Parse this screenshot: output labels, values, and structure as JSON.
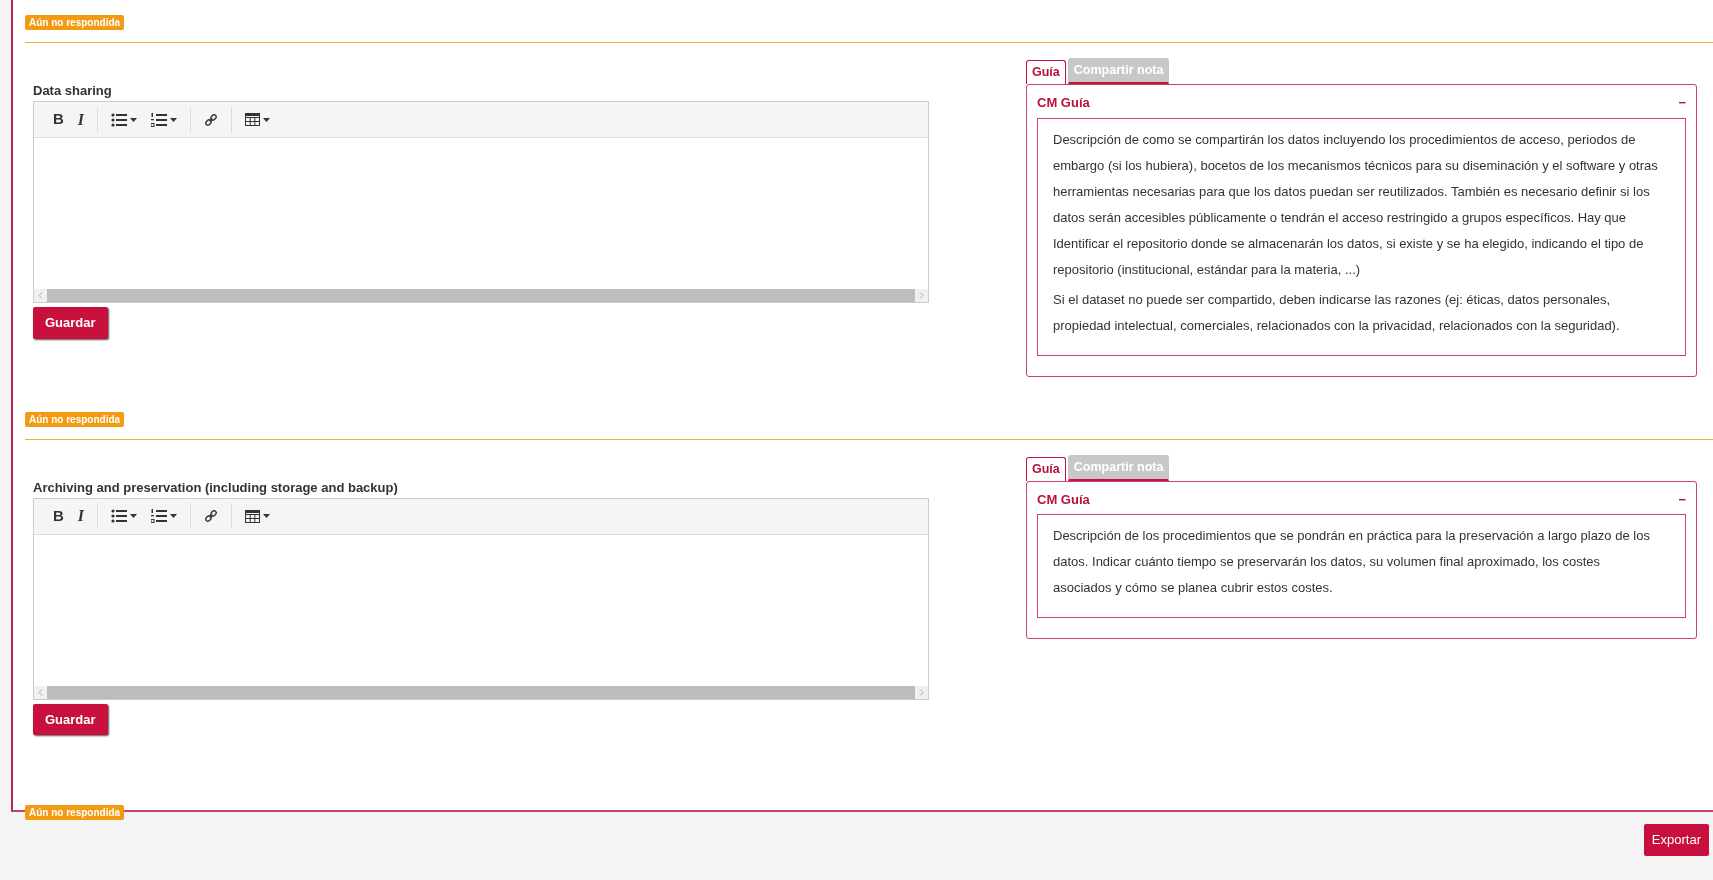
{
  "questions": [
    {
      "status": "Aún no respondida",
      "title": "Data sharing",
      "toolbar": [
        [
          {
            "kind": "bold",
            "label": "B"
          },
          {
            "kind": "italic",
            "label": "I"
          }
        ],
        [
          {
            "kind": "bullets",
            "dropdown": true
          },
          {
            "kind": "numbers",
            "dropdown": true
          }
        ],
        [
          {
            "kind": "link",
            "dropdown": false
          }
        ],
        [
          {
            "kind": "table",
            "dropdown": true
          }
        ]
      ],
      "save_button": "Guardar",
      "guide": {
        "tabs": [
          {
            "label": "Guía",
            "selected": true
          },
          {
            "label": "Compartir nota",
            "selected": false
          }
        ],
        "title": "CM Guía",
        "collapse": "−",
        "paragraphs": [
          "Descripción de como se compartirán los datos incluyendo los procedimientos de acceso, periodos de embargo (si los hubiera), bocetos de los mecanismos técnicos para su diseminación y el software y otras herramientas necesarias para que los datos puedan ser reutilizados. También es necesario definir si los datos serán accesibles públicamente o tendrán el acceso restringido a grupos específicos. Hay que Identificar el repositorio donde se almacenarán los datos, si existe y se ha elegido, indicando el tipo de repositorio (institucional, estándar para la materia, ...)",
          "Si el dataset no puede ser compartido, deben indicarse las razones (ej: éticas, datos personales, propiedad intelectual, comerciales, relacionados con la privacidad, relacionados con la seguridad)."
        ]
      }
    },
    {
      "status": "Aún no respondida",
      "title": "Archiving and preservation (including storage and backup)",
      "toolbar": [
        [
          {
            "kind": "bold",
            "label": "B"
          },
          {
            "kind": "italic",
            "label": "I"
          }
        ],
        [
          {
            "kind": "bullets",
            "dropdown": true
          },
          {
            "kind": "numbers",
            "dropdown": true
          }
        ],
        [
          {
            "kind": "link",
            "dropdown": false
          }
        ],
        [
          {
            "kind": "table",
            "dropdown": true
          }
        ]
      ],
      "save_button": "Guardar",
      "guide": {
        "tabs": [
          {
            "label": "Guía",
            "selected": true
          },
          {
            "label": "Compartir nota",
            "selected": false
          }
        ],
        "title": "CM Guía",
        "collapse": "−",
        "paragraphs": [
          "Descripción de los procedimientos que se pondrán en práctica para la preservación a largo plazo de los datos. Indicar cuánto tiempo se preservarán los datos, su volumen final aproximado, los costes asociados y cómo se planea cubrir estos costes."
        ]
      }
    }
  ],
  "trailing_status": "Aún no respondida",
  "export_button": "Exportar"
}
